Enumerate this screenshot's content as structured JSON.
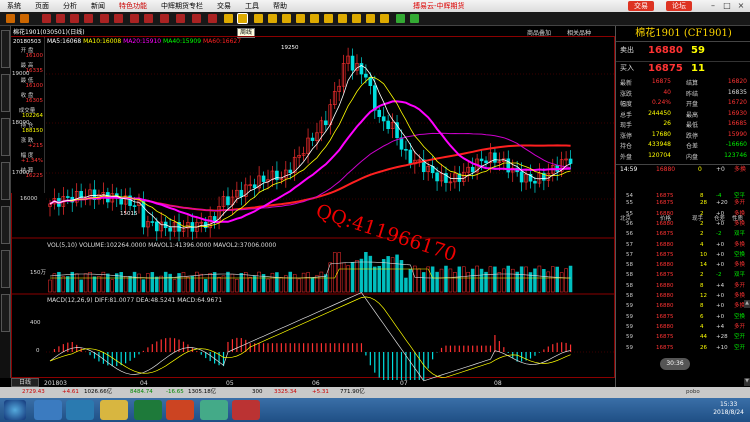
{
  "menubar": {
    "items": [
      "系统",
      "页面",
      "分析",
      "新闻",
      "特色功能",
      "中辉期货专栏",
      "交易",
      "工具",
      "帮助"
    ],
    "title": "搏易云-中辉期货",
    "trade_btn": "交易",
    "forum_btn": "论坛"
  },
  "toolbar": {
    "tooltip": "周线"
  },
  "chart": {
    "title": "棉花1901(030501)(日线)",
    "minitabs": [
      "商品叠加",
      "相关品种"
    ],
    "ma": {
      "ma5": "MA5:16068",
      "ma10": "MA10:16008",
      "ma20": "MA20:15910",
      "ma40": "MA40:15909",
      "ma60": "MA60:16627"
    },
    "vol_legend": "VOL(5,10) VOLUME:102264.0000 MAVOL1:41396.0000 MAVOL2:37006.0000",
    "macd_legend": "MACD(12,26,9) DIFF:81.0077 DEA:48.5241 MACD:64.9671",
    "price_labels": {
      "p19000": "19000",
      "p18000": "18000",
      "p17000": "17000",
      "p16000": "16000"
    },
    "high_mark": "19250",
    "low_mark": "15015",
    "vol_label": "150万",
    "macd_labels": {
      "m400": "400",
      "m0": "0",
      "m_400": "-400"
    },
    "x_labels": [
      "201803",
      "04",
      "05",
      "06",
      "07",
      "08"
    ],
    "subtab": "日线",
    "watermark": "QQ:411966170",
    "colors": {
      "ma5": "#ffffff",
      "ma10": "#ffff00",
      "ma20": "#ff00ff",
      "ma40": "#00ff00",
      "ma60": "#ff2020",
      "up": "#ff3030",
      "down": "#00e0e0"
    }
  },
  "infocol": [
    {
      "l": "20180503",
      "v": ""
    },
    {
      "l": "开 盘",
      "v": "16100"
    },
    {
      "l": "最 高",
      "v": "16335"
    },
    {
      "l": "最 低",
      "v": "16100"
    },
    {
      "l": "收 盘",
      "v": "16305"
    },
    {
      "l": "成交量",
      "v": "102264"
    },
    {
      "l": "持 仓",
      "v": "188150"
    },
    {
      "l": "涨 跌",
      "v": "+215"
    },
    {
      "l": "幅 度",
      "v": "+1.34%"
    },
    {
      "l": "结 算",
      "v": "16225"
    }
  ],
  "right_panel": {
    "title": "棉花1901 (CF1901)",
    "sell": {
      "label": "卖出",
      "price": "16880",
      "vol": "59"
    },
    "buy": {
      "label": "买入",
      "price": "16875",
      "vol": "11"
    },
    "quote": [
      [
        "最新",
        "16875",
        "结算",
        "16820"
      ],
      [
        "涨跌",
        "40",
        "昨结",
        "16835"
      ],
      [
        "幅度",
        "0.24%",
        "开盘",
        "16720"
      ],
      [
        "总手",
        "244450",
        "最高",
        "16930"
      ],
      [
        "现手",
        "26",
        "最低",
        "16685"
      ],
      [
        "涨停",
        "17680",
        "跌停",
        "15990"
      ],
      [
        "持仓",
        "433948",
        "仓差",
        "-16660"
      ],
      [
        "外盘",
        "120704",
        "内盘",
        "123746"
      ]
    ],
    "trade_header": {
      "time": "14:59",
      "price": "16880",
      "qty": "0",
      "change": "+0",
      "nature": "多换"
    },
    "trade_cols": [
      "北京",
      "价格",
      "现手",
      "仓差",
      "性质"
    ],
    "trades": [
      [
        "54",
        "16875",
        "8",
        "-4",
        "空平"
      ],
      [
        "55",
        "16875",
        "28",
        "+20",
        "多开"
      ],
      [
        "55",
        "16880",
        "2",
        "+0",
        "多换"
      ],
      [
        "56",
        "16880",
        "2",
        "+0",
        "多换"
      ],
      [
        "56",
        "16875",
        "2",
        "-2",
        "双平"
      ],
      [
        "57",
        "16880",
        "4",
        "+0",
        "多换"
      ],
      [
        "57",
        "16875",
        "10",
        "+0",
        "空换"
      ],
      [
        "58",
        "16880",
        "14",
        "+0",
        "多换"
      ],
      [
        "58",
        "16875",
        "2",
        "-2",
        "双平"
      ],
      [
        "58",
        "16880",
        "8",
        "+4",
        "多开"
      ],
      [
        "58",
        "16880",
        "12",
        "+0",
        "多换"
      ],
      [
        "59",
        "16880",
        "8",
        "+0",
        "多换"
      ],
      [
        "59",
        "16875",
        "6",
        "+0",
        "空换"
      ],
      [
        "59",
        "16880",
        "4",
        "+4",
        "多开"
      ],
      [
        "59",
        "16875",
        "44",
        "+28",
        "空开"
      ],
      [
        "59",
        "16875",
        "26",
        "+10",
        "空开"
      ]
    ],
    "time_badge": "30:36"
  },
  "status": {
    "items": [
      "2729.43",
      "+4.61",
      "1026.66亿",
      "8484.74",
      "-16.65",
      "1305.18亿",
      "300",
      "3325.34",
      "+5.31",
      "771.90亿"
    ],
    "right": "pobo"
  },
  "taskbar": {
    "time": "15:33",
    "date": "2018/8/24"
  }
}
